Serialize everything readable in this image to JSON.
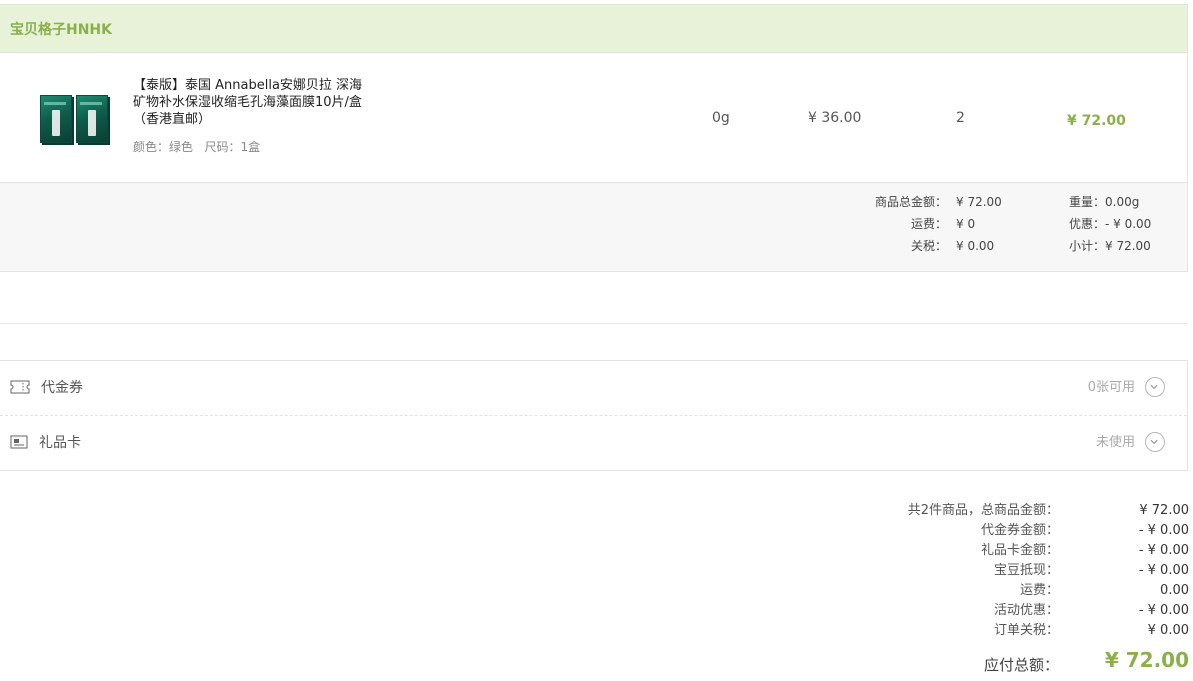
{
  "store": {
    "name": "宝贝格子HNHK"
  },
  "item": {
    "title": "【泰版】泰国 Annabella安娜贝拉 深海矿物补水保湿收缩毛孔海藻面膜10片/盒（香港直邮）",
    "attrs": "颜色：绿色   尺码：1盒",
    "weight": "0g",
    "unit_price": "¥ 36.00",
    "quantity": "2",
    "total": "¥ 72.00",
    "image": "product-box-icon"
  },
  "summary": {
    "goods_total_label": "商品总金额：",
    "goods_total_value": "¥ 72.00",
    "shipping_label": "运费：",
    "shipping_value": "¥ 0",
    "tax_label": "关税：",
    "tax_value": "¥ 0.00",
    "weight_label": "重量：",
    "weight_value": "0.00g",
    "discount_label": "优惠：",
    "discount_value": "- ¥ 0.00",
    "subtotal_label": "小计：",
    "subtotal_value": "¥ 72.00"
  },
  "discounts": {
    "voucher_label": "代金券",
    "voucher_status": "0张可用",
    "giftcard_label": "礼品卡",
    "giftcard_status": "未使用"
  },
  "totals": {
    "rows": [
      {
        "label": "共2件商品，总商品金额：",
        "value": "¥ 72.00"
      },
      {
        "label": "代金券金额：",
        "value": "- ¥ 0.00"
      },
      {
        "label": "礼品卡金额：",
        "value": "- ¥ 0.00"
      },
      {
        "label": "宝豆抵现：",
        "value": "- ¥ 0.00"
      },
      {
        "label": "运费：",
        "value": "0.00"
      },
      {
        "label": "活动优惠：",
        "value": "- ¥ 0.00"
      },
      {
        "label": "订单关税：",
        "value": "¥ 0.00"
      }
    ],
    "grand_label": "应付总额：",
    "grand_value": "¥ 72.00"
  },
  "colors": {
    "accent": "#8bb04a",
    "header_bg": "#e8f2d9"
  }
}
